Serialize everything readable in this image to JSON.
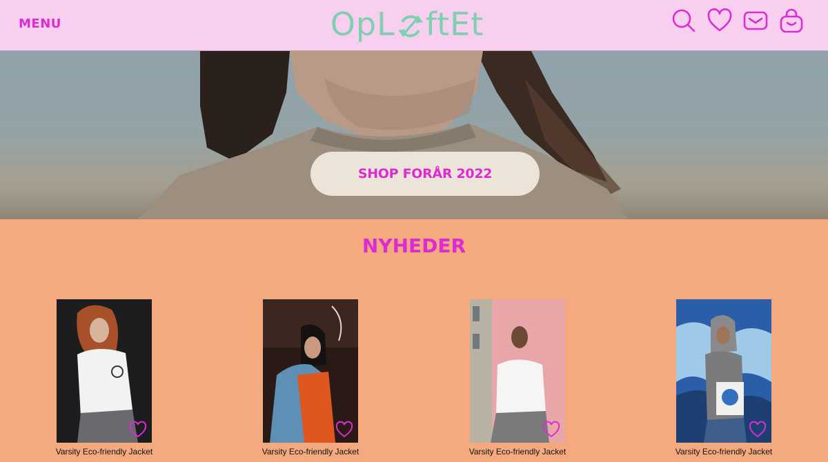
{
  "header": {
    "menu_label": "MENU",
    "logo_text_left": "OpL",
    "logo_text_right": "ftEt",
    "icons": [
      "search-icon",
      "heart-icon",
      "mail-icon",
      "shopping-bag-icon"
    ]
  },
  "hero": {
    "cta_label": "SHOP FORÅR 2022"
  },
  "new_section": {
    "title": "NYHEDER"
  },
  "products": [
    {
      "name": "Varsity Eco-friendly Jacket"
    },
    {
      "name": "Varsity Eco-friendly Jacket"
    },
    {
      "name": "Varsity Eco-friendly Jacket"
    },
    {
      "name": "Varsity Eco-friendly Jacket"
    }
  ],
  "colors": {
    "accent": "#dd2bd4",
    "header_bg": "#f9cff0",
    "page_bg": "#f5a97f",
    "logo": "#7fcfb1",
    "button_bg": "#ece4d9"
  }
}
